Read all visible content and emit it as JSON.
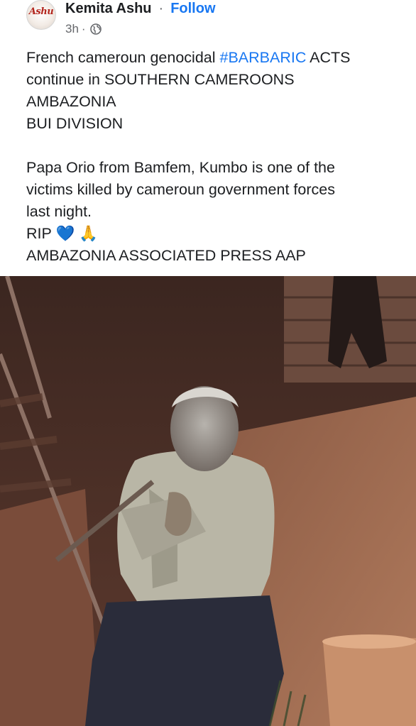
{
  "post": {
    "author": "Kemita Ashu",
    "separator": "·",
    "follow_label": "Follow",
    "time": "3h",
    "time_separator": "·",
    "privacy_icon": "globe-icon",
    "avatar_text": "Ashu",
    "text": {
      "line1_prefix": "French cameroun genocidal ",
      "hashtag": "#BARBARIC",
      "line1_suffix": " ACTS",
      "line2": "continue in SOUTHERN CAMEROONS",
      "line3": "AMBAZONIA",
      "line4": "BUI DIVISION",
      "line5": "Papa Orio from Bamfem, Kumbo is one of the",
      "line6": "victims killed by cameroun government forces",
      "line7": "last night.",
      "line8_prefix": "RIP ",
      "line8_emoji": "💙 🙏",
      "line9": "AMBAZONIA ASSOCIATED PRESS AAP"
    },
    "colors": {
      "link": "#1877f2",
      "text": "#1c1e21",
      "meta": "#65676b"
    }
  }
}
